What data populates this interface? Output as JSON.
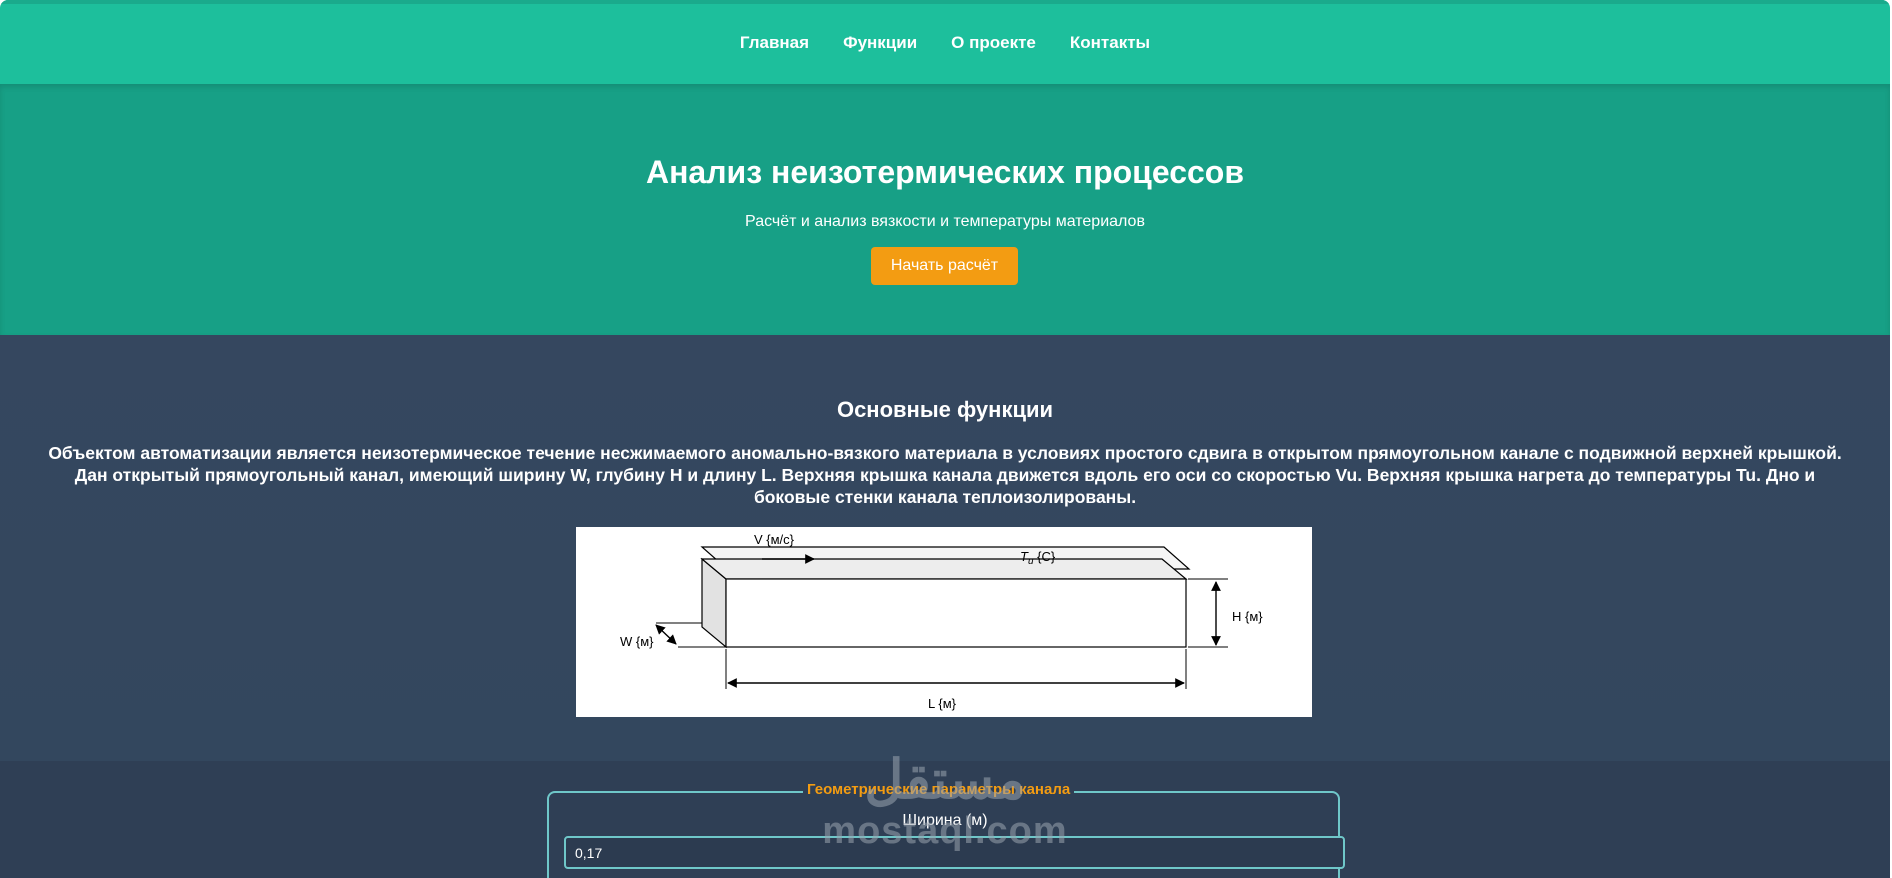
{
  "nav": {
    "items": [
      "Главная",
      "Функции",
      "О проекте",
      "Контакты"
    ]
  },
  "hero": {
    "title": "Анализ неизотермических процессов",
    "subtitle": "Расчёт и анализ вязкости и температуры материалов",
    "start_label": "Начать расчёт"
  },
  "functions": {
    "title": "Основные функции",
    "description": "Объектом автоматизации является неизотермическое течение несжимаемого аномально-вязкого материала в условиях простого сдвига в открытом прямоугольном канале с подвижной верхней крышкой. Дан открытый прямоугольный канал, имеющий ширину W, глубину H и длину L. Верхняя крышка канала движется вдоль его оси со скоростью Vu. Верхняя крышка нагрета до температуры Tu. Дно и боковые стенки канала теплоизолированы.",
    "diagram": {
      "velocity_label": "V {м/с}",
      "temp_label_main": "T",
      "temp_label_sub": "u",
      "temp_label_unit": " {C}",
      "height_label": "H {м}",
      "width_label": "W {м}",
      "length_label": "L {м}"
    }
  },
  "params": {
    "legend": "Геометрические параметры канала",
    "width_label": "Ширина (м)",
    "width_value": "0,17"
  },
  "watermark": {
    "arabic": "مستقل",
    "latin": "mostaql.com"
  },
  "colors": {
    "nav_bg": "#1dbf9c",
    "hero_bg": "#17a086",
    "section_bg": "#35475f",
    "accent": "#f39c12",
    "border": "#6fc7c9"
  }
}
